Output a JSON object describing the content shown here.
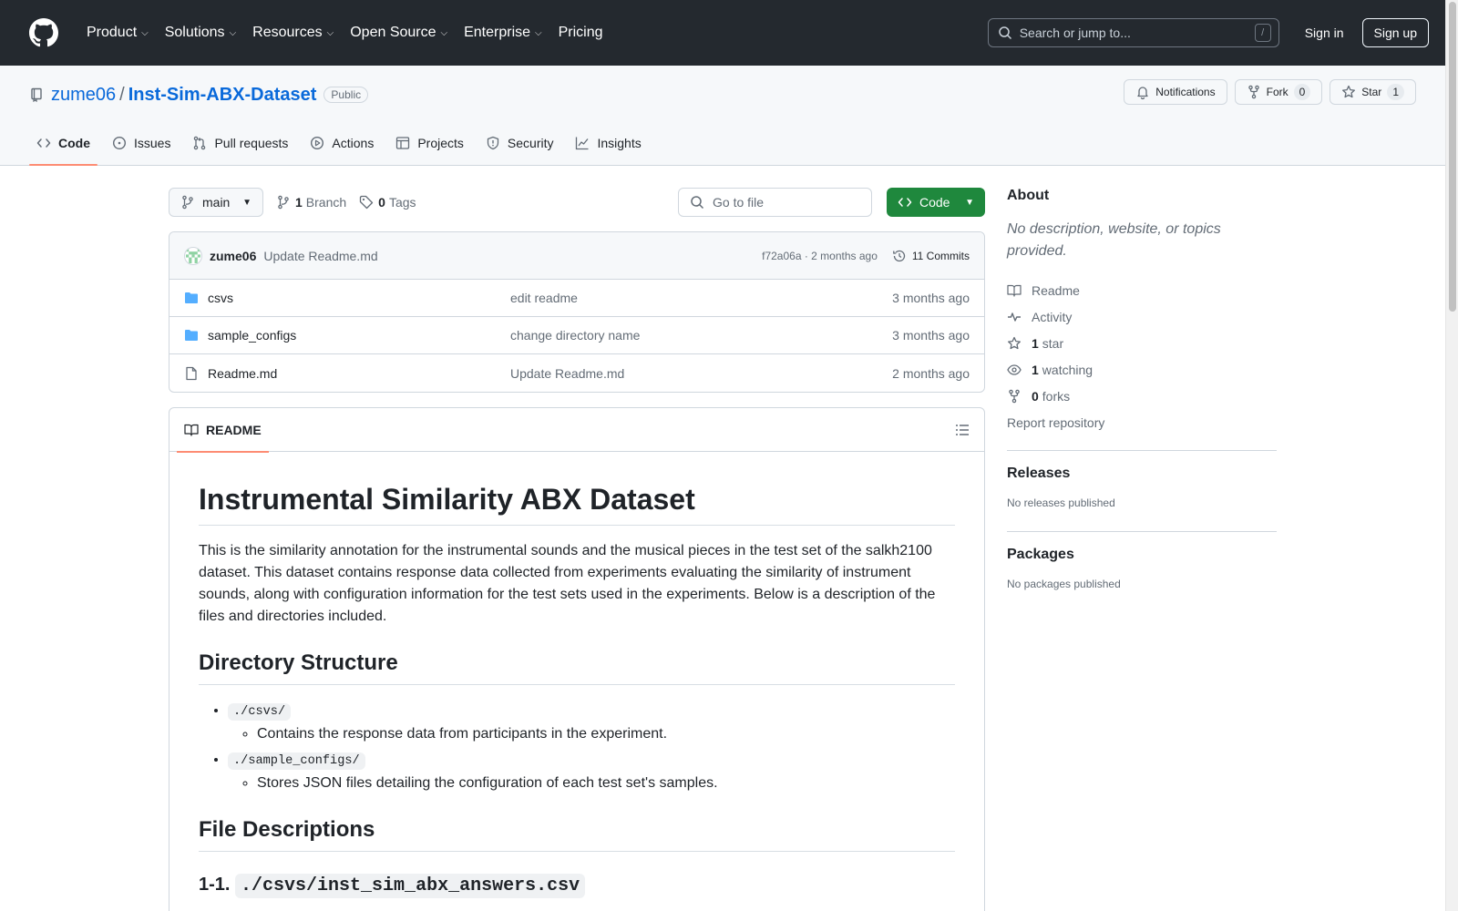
{
  "header": {
    "nav": [
      "Product",
      "Solutions",
      "Resources",
      "Open Source",
      "Enterprise",
      "Pricing"
    ],
    "search_placeholder": "Search or jump to...",
    "search_kbd": "/",
    "signin": "Sign in",
    "signup": "Sign up"
  },
  "repo": {
    "owner": "zume06",
    "sep": "/",
    "name": "Inst-Sim-ABX-Dataset",
    "visibility": "Public",
    "notifications": "Notifications",
    "fork_label": "Fork",
    "fork_count": "0",
    "star_label": "Star",
    "star_count": "1",
    "tabs": [
      "Code",
      "Issues",
      "Pull requests",
      "Actions",
      "Projects",
      "Security",
      "Insights"
    ]
  },
  "filebar": {
    "branch": "main",
    "branch_count": "1",
    "branch_label": "Branch",
    "tag_count": "0",
    "tag_label": "Tags",
    "goto_placeholder": "Go to file",
    "code_btn": "Code"
  },
  "commit": {
    "user": "zume06",
    "message": "Update Readme.md",
    "hash_time": "f72a06a · 2 months ago",
    "commits": "11 Commits"
  },
  "files": [
    {
      "name": "csvs",
      "type": "dir",
      "message": "edit readme",
      "date": "3 months ago"
    },
    {
      "name": "sample_configs",
      "type": "dir",
      "message": "change directory name",
      "date": "3 months ago"
    },
    {
      "name": "Readme.md",
      "type": "file",
      "message": "Update Readme.md",
      "date": "2 months ago"
    }
  ],
  "readme": {
    "tab": "README",
    "h1": "Instrumental Similarity ABX Dataset",
    "intro": "This is the similarity annotation for the instrumental sounds and the musical pieces in the test set of the salkh2100 dataset. This dataset contains response data collected from experiments evaluating the similarity of instrument sounds, along with configuration information for the test sets used in the experiments. Below is a description of the files and directories included.",
    "h2_dir": "Directory Structure",
    "dir_items": [
      {
        "code": "./csvs/",
        "desc": "Contains the response data from participants in the experiment."
      },
      {
        "code": "./sample_configs/",
        "desc": "Stores JSON files detailing the configuration of each test set's samples."
      }
    ],
    "h2_files": "File Descriptions",
    "h3_prefix": "1-1.",
    "h3_code": "./csvs/inst_sim_abx_answers.csv"
  },
  "sidebar": {
    "about_title": "About",
    "about_desc": "No description, website, or topics provided.",
    "readme": "Readme",
    "activity": "Activity",
    "stars_count": "1",
    "stars_label": "star",
    "watching_count": "1",
    "watching_label": "watching",
    "forks_count": "0",
    "forks_label": "forks",
    "report": "Report repository",
    "releases_title": "Releases",
    "releases_sub": "No releases published",
    "packages_title": "Packages",
    "packages_sub": "No packages published"
  }
}
